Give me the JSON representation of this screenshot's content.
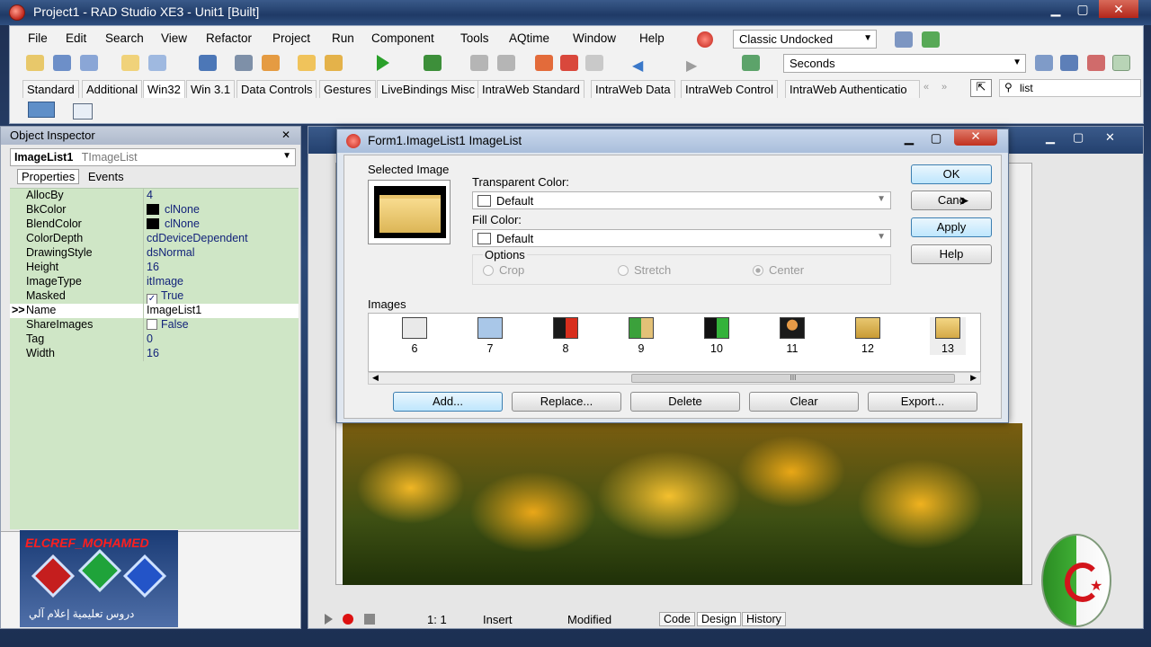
{
  "window": {
    "title": "Project1 - RAD Studio XE3 - Unit1 [Built]"
  },
  "menu": [
    "File",
    "Edit",
    "Search",
    "View",
    "Refactor",
    "Project",
    "Run",
    "Component",
    "Tools",
    "AQtime",
    "Window",
    "Help"
  ],
  "desktop_combo": {
    "value": "Classic Undocked"
  },
  "toolbar": {
    "seconds_combo": "Seconds"
  },
  "palette": {
    "tabs": [
      "Standard",
      "Additional",
      "Win32",
      "Win 3.1",
      "Data Controls",
      "Gestures",
      "LiveBindings Misc",
      "IntraWeb Standard",
      "IntraWeb Data",
      "IntraWeb Control",
      "IntraWeb Authenticatio"
    ],
    "active_tab": "Win32",
    "search_value": "list"
  },
  "object_inspector": {
    "title": "Object Inspector",
    "selected_object": "ImageList1",
    "selected_type": "TImageList",
    "tabs": [
      "Properties",
      "Events"
    ],
    "selected_marker": ">>",
    "properties": [
      {
        "name": "AllocBy",
        "value": "4"
      },
      {
        "name": "BkColor",
        "value": "clNone"
      },
      {
        "name": "BlendColor",
        "value": "clNone"
      },
      {
        "name": "ColorDepth",
        "value": "cdDeviceDependent"
      },
      {
        "name": "DrawingStyle",
        "value": "dsNormal"
      },
      {
        "name": "Height",
        "value": "16"
      },
      {
        "name": "ImageType",
        "value": "itImage"
      },
      {
        "name": "Masked",
        "value": "True"
      },
      {
        "name": "Name",
        "value": "ImageList1"
      },
      {
        "name": "ShareImages",
        "value": "False"
      },
      {
        "name": "Tag",
        "value": "0"
      },
      {
        "name": "Width",
        "value": "16"
      }
    ]
  },
  "logo": {
    "title": "ELCREF_MOHAMED",
    "subtitle": "دروس تعليمية إعلام آلي"
  },
  "dialog": {
    "title": "Form1.ImageList1 ImageList",
    "selected_image_label": "Selected Image",
    "transparent_color_label": "Transparent Color:",
    "transparent_color_value": "Default",
    "fill_color_label": "Fill Color:",
    "fill_color_value": "Default",
    "options_label": "Options",
    "options": [
      "Crop",
      "Stretch",
      "Center"
    ],
    "images_label": "Images",
    "images": [
      "6",
      "7",
      "8",
      "9",
      "10",
      "11",
      "12",
      "13"
    ],
    "buttons": {
      "ok": "OK",
      "cancel": "Canc",
      "apply": "Apply",
      "help": "Help"
    },
    "actions": {
      "add": "Add...",
      "replace": "Replace...",
      "delete": "Delete",
      "clear": "Clear",
      "export": "Export..."
    },
    "scroll_thumb": "III"
  },
  "status": {
    "position": "1:   1",
    "mode": "Insert",
    "state": "Modified",
    "tabs": [
      "Code",
      "Design",
      "History"
    ]
  },
  "colors": {
    "accent": "#3c7fb1",
    "grid_bg": "#cfe6c6",
    "title_bar": "#23406e"
  }
}
